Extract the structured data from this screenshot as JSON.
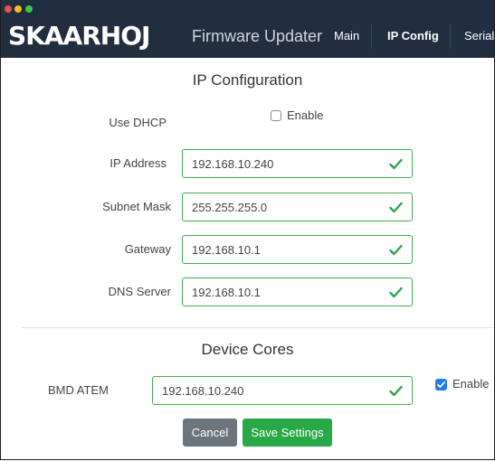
{
  "header": {
    "logo": "SKAARHOJ",
    "app_title": "Firmware Updater",
    "nav": [
      "Main",
      "IP Config",
      "Serial"
    ],
    "active_nav": "IP Config"
  },
  "ip_config": {
    "title": "IP Configuration",
    "dhcp": {
      "label": "Use DHCP",
      "checkbox_label": "Enable",
      "checked": false
    },
    "fields": [
      {
        "label": "IP Address",
        "value": "192.168.10.240",
        "valid": true
      },
      {
        "label": "Subnet Mask",
        "value": "255.255.255.0",
        "valid": true
      },
      {
        "label": "Gateway",
        "value": "192.168.10.1",
        "valid": true
      },
      {
        "label": "DNS Server",
        "value": "192.168.10.1",
        "valid": true
      }
    ]
  },
  "device_cores": {
    "title": "Device Cores",
    "cores": [
      {
        "label": "BMD ATEM",
        "value": "192.168.10.240",
        "valid": true,
        "enable_label": "Enable",
        "enabled": true
      }
    ]
  },
  "actions": {
    "cancel_label": "Cancel",
    "save_label": "Save Settings"
  },
  "colors": {
    "header_bg": "#202e3f",
    "valid_border": "#44ad4f",
    "check_green": "#2ea44f",
    "checkbox_blue": "#1f7af0",
    "cancel_bg": "#6b757d",
    "save_bg": "#28a846"
  }
}
